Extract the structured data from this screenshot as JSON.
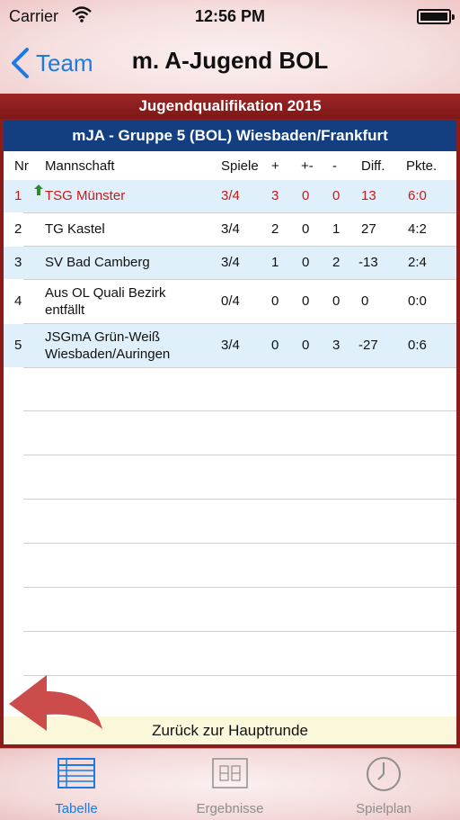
{
  "status_bar": {
    "carrier": "Carrier",
    "time": "12:56 PM"
  },
  "nav": {
    "back_label": "Team",
    "title": "m. A-Jugend BOL"
  },
  "section_title": "Jugendqualifikation 2015",
  "group_title": "mJA - Gruppe 5 (BOL) Wiesbaden/Frankfurt",
  "table": {
    "headers": {
      "nr": "Nr",
      "team": "Mannschaft",
      "games": "Spiele",
      "won": "+",
      "draw": "+-",
      "lost": "-",
      "diff": "Diff.",
      "points": "Pkte."
    },
    "rows": [
      {
        "nr": "1",
        "team_line1": "TSG Münster",
        "team_line2": "",
        "games": "3/4",
        "won": "3",
        "draw": "0",
        "lost": "0",
        "diff": "13",
        "points": "6:0"
      },
      {
        "nr": "2",
        "team_line1": "TG Kastel",
        "team_line2": "",
        "games": "3/4",
        "won": "2",
        "draw": "0",
        "lost": "1",
        "diff": "27",
        "points": "4:2"
      },
      {
        "nr": "3",
        "team_line1": "SV Bad Camberg",
        "team_line2": "",
        "games": "3/4",
        "won": "1",
        "draw": "0",
        "lost": "2",
        "diff": "-13",
        "points": "2:4"
      },
      {
        "nr": "4",
        "team_line1": "Aus OL Quali Bezirk",
        "team_line2": "entfällt",
        "games": "0/4",
        "won": "0",
        "draw": "0",
        "lost": "0",
        "diff": "0",
        "points": "0:0"
      },
      {
        "nr": "5",
        "team_line1": "JSGmA Grün-Weiß",
        "team_line2": "Wiesbaden/Auringen",
        "games": "3/4",
        "won": "0",
        "draw": "0",
        "lost": "3",
        "diff": "-27",
        "points": "0:6"
      }
    ]
  },
  "footer_label": "Zurück zur Hauptrunde",
  "tabs": [
    {
      "label": "Tabelle",
      "icon": "table-icon",
      "active": true
    },
    {
      "label": "Ergebnisse",
      "icon": "scoreboard-icon",
      "active": false
    },
    {
      "label": "Spielplan",
      "icon": "clock-icon",
      "active": false
    }
  ],
  "colors": {
    "accent_blue": "#1a7ae6",
    "header_red": "#8b1c1c",
    "group_blue": "#133f80",
    "highlight_red": "#c61a1a",
    "row_alt": "#dff0fb",
    "footer_bg": "#fbf7da",
    "arrow_red": "#cc4b4b"
  }
}
